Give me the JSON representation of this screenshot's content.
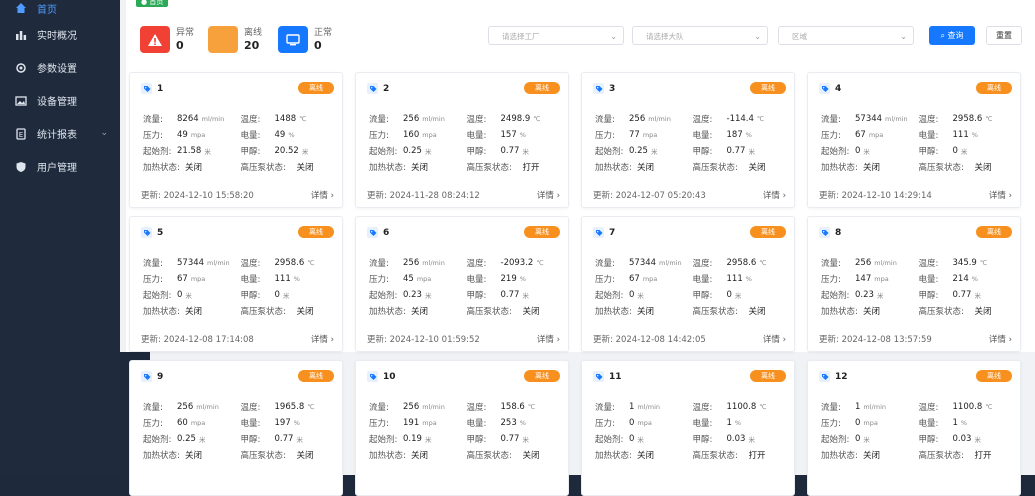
{
  "sidebar": {
    "items": [
      {
        "label": "首页",
        "icon": "home-icon",
        "active": true
      },
      {
        "label": "实时概况",
        "icon": "bar-chart-icon"
      },
      {
        "label": "参数设置",
        "icon": "settings-cloud-icon"
      },
      {
        "label": "设备管理",
        "icon": "image-icon"
      },
      {
        "label": "统计报表",
        "icon": "report-icon",
        "expandable": true
      },
      {
        "label": "用户管理",
        "icon": "shield-icon"
      }
    ]
  },
  "tags": {
    "home": "首页"
  },
  "stats": [
    {
      "label": "异常",
      "value": "0",
      "color": "#f04134"
    },
    {
      "label": "离线",
      "value": "20",
      "color": "#f7a13c"
    },
    {
      "label": "正常",
      "value": "0",
      "color": "#1677ff"
    }
  ],
  "filters": {
    "factory": "请选择工厂",
    "team": "请选择大队",
    "area": "区域",
    "query": "查询",
    "reset": "重置"
  },
  "cards": [
    {
      "id": "1",
      "status": "离线",
      "flow": "8264",
      "flow_unit": "ml/min",
      "temp": "1488",
      "temp_unit": "℃",
      "pressure": "49",
      "pressure_unit": "mpa",
      "power": "49",
      "power_unit": "%",
      "startpos": "21.58",
      "startpos_unit": "米",
      "methanol": "20.52",
      "methanol_unit": "米",
      "heat": "关闭",
      "pump": "关闭",
      "updated": "更新: 2024-12-10 15:58:20",
      "detail": "详情 ›"
    },
    {
      "id": "2",
      "status": "离线",
      "flow": "256",
      "flow_unit": "ml/min",
      "temp": "2498.9",
      "temp_unit": "℃",
      "pressure": "160",
      "pressure_unit": "mpa",
      "power": "157",
      "power_unit": "%",
      "startpos": "0.25",
      "startpos_unit": "米",
      "methanol": "0.77",
      "methanol_unit": "米",
      "heat": "关闭",
      "pump": "打开",
      "updated": "更新: 2024-11-28 08:24:12",
      "detail": "详情 ›"
    },
    {
      "id": "3",
      "status": "离线",
      "flow": "256",
      "flow_unit": "ml/min",
      "temp": "-114.4",
      "temp_unit": "℃",
      "pressure": "77",
      "pressure_unit": "mpa",
      "power": "187",
      "power_unit": "%",
      "startpos": "0.25",
      "startpos_unit": "米",
      "methanol": "0.77",
      "methanol_unit": "米",
      "heat": "关闭",
      "pump": "关闭",
      "updated": "更新: 2024-12-07 05:20:43",
      "detail": "详情 ›"
    },
    {
      "id": "4",
      "status": "离线",
      "flow": "57344",
      "flow_unit": "ml/min",
      "temp": "2958.6",
      "temp_unit": "℃",
      "pressure": "67",
      "pressure_unit": "mpa",
      "power": "111",
      "power_unit": "%",
      "startpos": "0",
      "startpos_unit": "米",
      "methanol": "0",
      "methanol_unit": "米",
      "heat": "关闭",
      "pump": "关闭",
      "updated": "更新: 2024-12-10 14:29:14",
      "detail": "详情 ›"
    },
    {
      "id": "5",
      "status": "离线",
      "flow": "57344",
      "flow_unit": "ml/min",
      "temp": "2958.6",
      "temp_unit": "℃",
      "pressure": "67",
      "pressure_unit": "mpa",
      "power": "111",
      "power_unit": "%",
      "startpos": "0",
      "startpos_unit": "米",
      "methanol": "0",
      "methanol_unit": "米",
      "heat": "关闭",
      "pump": "关闭",
      "updated": "更新: 2024-12-08 17:14:08",
      "detail": "详情 ›"
    },
    {
      "id": "6",
      "status": "离线",
      "flow": "256",
      "flow_unit": "ml/min",
      "temp": "-2093.2",
      "temp_unit": "℃",
      "pressure": "45",
      "pressure_unit": "mpa",
      "power": "219",
      "power_unit": "%",
      "startpos": "0.23",
      "startpos_unit": "米",
      "methanol": "0.77",
      "methanol_unit": "米",
      "heat": "关闭",
      "pump": "关闭",
      "updated": "更新: 2024-12-10 01:59:52",
      "detail": "详情 ›"
    },
    {
      "id": "7",
      "status": "离线",
      "flow": "57344",
      "flow_unit": "ml/min",
      "temp": "2958.6",
      "temp_unit": "℃",
      "pressure": "67",
      "pressure_unit": "mpa",
      "power": "111",
      "power_unit": "%",
      "startpos": "0",
      "startpos_unit": "米",
      "methanol": "0",
      "methanol_unit": "米",
      "heat": "关闭",
      "pump": "关闭",
      "updated": "更新: 2024-12-08 14:42:05",
      "detail": "详情 ›"
    },
    {
      "id": "8",
      "status": "离线",
      "flow": "256",
      "flow_unit": "ml/min",
      "temp": "345.9",
      "temp_unit": "℃",
      "pressure": "147",
      "pressure_unit": "mpa",
      "power": "214",
      "power_unit": "%",
      "startpos": "0.23",
      "startpos_unit": "米",
      "methanol": "0.77",
      "methanol_unit": "米",
      "heat": "关闭",
      "pump": "关闭",
      "updated": "更新: 2024-12-08 13:57:59",
      "detail": "详情 ›"
    },
    {
      "id": "9",
      "status": "离线",
      "flow": "256",
      "flow_unit": "ml/min",
      "temp": "1965.8",
      "temp_unit": "℃",
      "pressure": "60",
      "pressure_unit": "mpa",
      "power": "197",
      "power_unit": "%",
      "startpos": "0.25",
      "startpos_unit": "米",
      "methanol": "0.77",
      "methanol_unit": "米",
      "heat": "关闭",
      "pump": "关闭",
      "updated": "",
      "detail": ""
    },
    {
      "id": "10",
      "status": "离线",
      "flow": "256",
      "flow_unit": "ml/min",
      "temp": "158.6",
      "temp_unit": "℃",
      "pressure": "191",
      "pressure_unit": "mpa",
      "power": "253",
      "power_unit": "%",
      "startpos": "0.19",
      "startpos_unit": "米",
      "methanol": "0.77",
      "methanol_unit": "米",
      "heat": "关闭",
      "pump": "关闭",
      "updated": "",
      "detail": ""
    },
    {
      "id": "11",
      "status": "离线",
      "flow": "1",
      "flow_unit": "ml/min",
      "temp": "1100.8",
      "temp_unit": "℃",
      "pressure": "0",
      "pressure_unit": "mpa",
      "power": "1",
      "power_unit": "%",
      "startpos": "0",
      "startpos_unit": "米",
      "methanol": "0.03",
      "methanol_unit": "米",
      "heat": "关闭",
      "pump": "打开",
      "updated": "",
      "detail": ""
    },
    {
      "id": "12",
      "status": "离线",
      "flow": "1",
      "flow_unit": "ml/min",
      "temp": "1100.8",
      "temp_unit": "℃",
      "pressure": "0",
      "pressure_unit": "mpa",
      "power": "1",
      "power_unit": "%",
      "startpos": "0",
      "startpos_unit": "米",
      "methanol": "0.03",
      "methanol_unit": "米",
      "heat": "关闭",
      "pump": "打开",
      "updated": "",
      "detail": ""
    }
  ],
  "labels": {
    "flow": "流量:",
    "temp": "温度:",
    "pressure": "压力:",
    "power": "电量:",
    "startpos": "起始剂:",
    "methanol": "甲醇:",
    "heat": "加热状态:",
    "pump": "高压泵状态:"
  }
}
